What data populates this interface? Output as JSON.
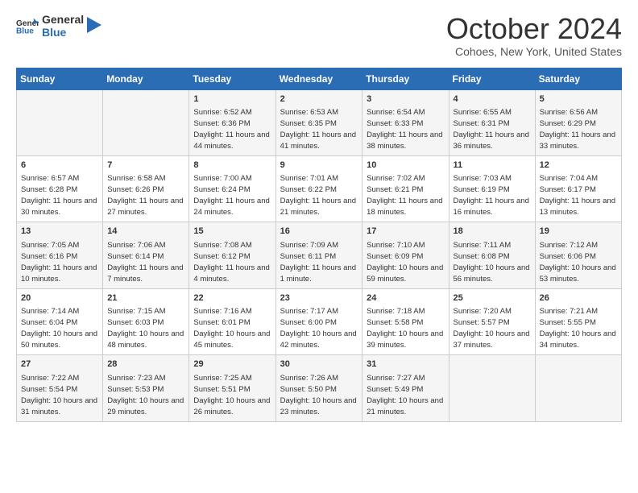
{
  "header": {
    "logo_line1": "General",
    "logo_line2": "Blue",
    "month_title": "October 2024",
    "location": "Cohoes, New York, United States"
  },
  "days_of_week": [
    "Sunday",
    "Monday",
    "Tuesday",
    "Wednesday",
    "Thursday",
    "Friday",
    "Saturday"
  ],
  "weeks": [
    [
      {
        "day": "",
        "info": ""
      },
      {
        "day": "",
        "info": ""
      },
      {
        "day": "1",
        "info": "Sunrise: 6:52 AM\nSunset: 6:36 PM\nDaylight: 11 hours and 44 minutes."
      },
      {
        "day": "2",
        "info": "Sunrise: 6:53 AM\nSunset: 6:35 PM\nDaylight: 11 hours and 41 minutes."
      },
      {
        "day": "3",
        "info": "Sunrise: 6:54 AM\nSunset: 6:33 PM\nDaylight: 11 hours and 38 minutes."
      },
      {
        "day": "4",
        "info": "Sunrise: 6:55 AM\nSunset: 6:31 PM\nDaylight: 11 hours and 36 minutes."
      },
      {
        "day": "5",
        "info": "Sunrise: 6:56 AM\nSunset: 6:29 PM\nDaylight: 11 hours and 33 minutes."
      }
    ],
    [
      {
        "day": "6",
        "info": "Sunrise: 6:57 AM\nSunset: 6:28 PM\nDaylight: 11 hours and 30 minutes."
      },
      {
        "day": "7",
        "info": "Sunrise: 6:58 AM\nSunset: 6:26 PM\nDaylight: 11 hours and 27 minutes."
      },
      {
        "day": "8",
        "info": "Sunrise: 7:00 AM\nSunset: 6:24 PM\nDaylight: 11 hours and 24 minutes."
      },
      {
        "day": "9",
        "info": "Sunrise: 7:01 AM\nSunset: 6:22 PM\nDaylight: 11 hours and 21 minutes."
      },
      {
        "day": "10",
        "info": "Sunrise: 7:02 AM\nSunset: 6:21 PM\nDaylight: 11 hours and 18 minutes."
      },
      {
        "day": "11",
        "info": "Sunrise: 7:03 AM\nSunset: 6:19 PM\nDaylight: 11 hours and 16 minutes."
      },
      {
        "day": "12",
        "info": "Sunrise: 7:04 AM\nSunset: 6:17 PM\nDaylight: 11 hours and 13 minutes."
      }
    ],
    [
      {
        "day": "13",
        "info": "Sunrise: 7:05 AM\nSunset: 6:16 PM\nDaylight: 11 hours and 10 minutes."
      },
      {
        "day": "14",
        "info": "Sunrise: 7:06 AM\nSunset: 6:14 PM\nDaylight: 11 hours and 7 minutes."
      },
      {
        "day": "15",
        "info": "Sunrise: 7:08 AM\nSunset: 6:12 PM\nDaylight: 11 hours and 4 minutes."
      },
      {
        "day": "16",
        "info": "Sunrise: 7:09 AM\nSunset: 6:11 PM\nDaylight: 11 hours and 1 minute."
      },
      {
        "day": "17",
        "info": "Sunrise: 7:10 AM\nSunset: 6:09 PM\nDaylight: 10 hours and 59 minutes."
      },
      {
        "day": "18",
        "info": "Sunrise: 7:11 AM\nSunset: 6:08 PM\nDaylight: 10 hours and 56 minutes."
      },
      {
        "day": "19",
        "info": "Sunrise: 7:12 AM\nSunset: 6:06 PM\nDaylight: 10 hours and 53 minutes."
      }
    ],
    [
      {
        "day": "20",
        "info": "Sunrise: 7:14 AM\nSunset: 6:04 PM\nDaylight: 10 hours and 50 minutes."
      },
      {
        "day": "21",
        "info": "Sunrise: 7:15 AM\nSunset: 6:03 PM\nDaylight: 10 hours and 48 minutes."
      },
      {
        "day": "22",
        "info": "Sunrise: 7:16 AM\nSunset: 6:01 PM\nDaylight: 10 hours and 45 minutes."
      },
      {
        "day": "23",
        "info": "Sunrise: 7:17 AM\nSunset: 6:00 PM\nDaylight: 10 hours and 42 minutes."
      },
      {
        "day": "24",
        "info": "Sunrise: 7:18 AM\nSunset: 5:58 PM\nDaylight: 10 hours and 39 minutes."
      },
      {
        "day": "25",
        "info": "Sunrise: 7:20 AM\nSunset: 5:57 PM\nDaylight: 10 hours and 37 minutes."
      },
      {
        "day": "26",
        "info": "Sunrise: 7:21 AM\nSunset: 5:55 PM\nDaylight: 10 hours and 34 minutes."
      }
    ],
    [
      {
        "day": "27",
        "info": "Sunrise: 7:22 AM\nSunset: 5:54 PM\nDaylight: 10 hours and 31 minutes."
      },
      {
        "day": "28",
        "info": "Sunrise: 7:23 AM\nSunset: 5:53 PM\nDaylight: 10 hours and 29 minutes."
      },
      {
        "day": "29",
        "info": "Sunrise: 7:25 AM\nSunset: 5:51 PM\nDaylight: 10 hours and 26 minutes."
      },
      {
        "day": "30",
        "info": "Sunrise: 7:26 AM\nSunset: 5:50 PM\nDaylight: 10 hours and 23 minutes."
      },
      {
        "day": "31",
        "info": "Sunrise: 7:27 AM\nSunset: 5:49 PM\nDaylight: 10 hours and 21 minutes."
      },
      {
        "day": "",
        "info": ""
      },
      {
        "day": "",
        "info": ""
      }
    ]
  ]
}
